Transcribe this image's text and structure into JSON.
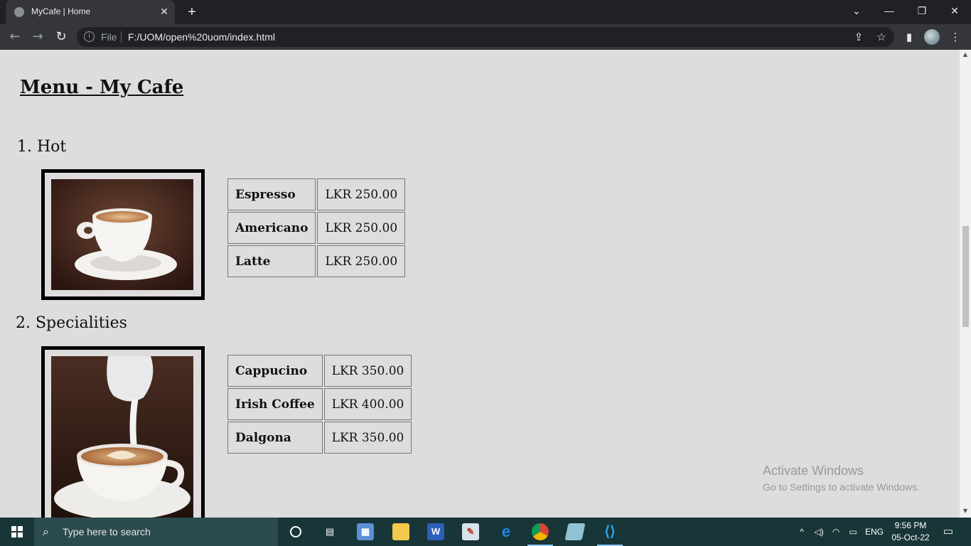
{
  "browser": {
    "tab_title": "MyCafe | Home",
    "tab_close": "✕",
    "new_tab": "+",
    "window_controls": {
      "list": "⌄",
      "minimize": "—",
      "restore": "❐",
      "close": "✕"
    },
    "nav": {
      "back": "←",
      "forward": "→",
      "reload": "↻"
    },
    "address": {
      "info": "i",
      "scheme_label": "File",
      "url": "F:/UOM/open%20uom/index.html"
    },
    "toolbar_icons": {
      "share": "⇪",
      "bookmark": "☆",
      "side_panel": "▮",
      "menu": "⋮"
    }
  },
  "page": {
    "heading": "Menu - My Cafe",
    "sections": [
      {
        "title": "1. Hot",
        "image_alt": "espresso-cup",
        "items": [
          {
            "name": "Espresso",
            "price": "LKR 250.00"
          },
          {
            "name": "Americano",
            "price": "LKR 250.00"
          },
          {
            "name": "Latte",
            "price": "LKR 250.00"
          }
        ]
      },
      {
        "title": "2. Specialities",
        "image_alt": "milk-pour-latte-art",
        "items": [
          {
            "name": "Cappucino",
            "price": "LKR 350.00"
          },
          {
            "name": "Irish Coffee",
            "price": "LKR 400.00"
          },
          {
            "name": "Dalgona",
            "price": "LKR 350.00"
          }
        ]
      }
    ]
  },
  "watermark": {
    "line1": "Activate Windows",
    "line2": "Go to Settings to activate Windows."
  },
  "taskbar": {
    "search_placeholder": "Type here to search",
    "apps": [
      "cortana",
      "task-view",
      "control-panel",
      "file-explorer",
      "word",
      "paint",
      "edge",
      "chrome",
      "notepad",
      "vscode"
    ],
    "tray": {
      "language": "ENG",
      "time": "9:56 PM",
      "date": "05-Oct-22"
    }
  },
  "colors": {
    "page_bg": "#dedcdd",
    "chrome_dark": "#202124",
    "chrome_toolbar": "#35363a",
    "taskbar": "#183538"
  }
}
